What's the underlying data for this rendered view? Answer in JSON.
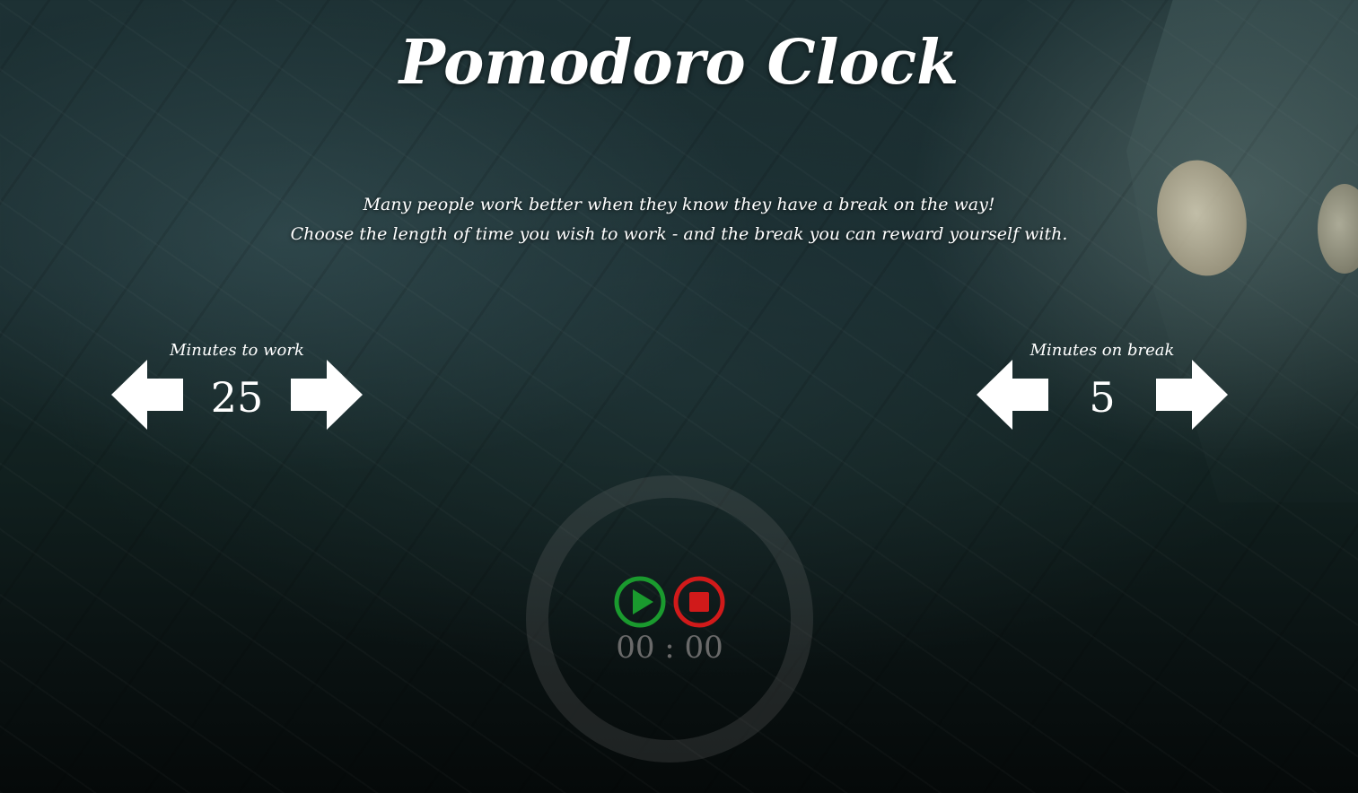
{
  "page": {
    "title": "Pomodoro Clock",
    "intro_line1": "Many people work better when they know they have a break on the way!",
    "intro_line2": "Choose the length of time you wish to work - and the break you can reward yourself with."
  },
  "work": {
    "label": "Minutes to work",
    "value": "25",
    "decrease_icon": "left-arrow-icon",
    "increase_icon": "right-arrow-icon"
  },
  "break": {
    "label": "Minutes on break",
    "value": "5",
    "decrease_icon": "left-arrow-icon",
    "increase_icon": "right-arrow-icon"
  },
  "timer": {
    "readout": "00 : 00",
    "play_icon": "play-icon",
    "stop_icon": "stop-icon"
  },
  "colors": {
    "play": "#1a9a2e",
    "stop": "#d11a1a",
    "text": "#ffffff",
    "readout": "#6a6a6a"
  }
}
